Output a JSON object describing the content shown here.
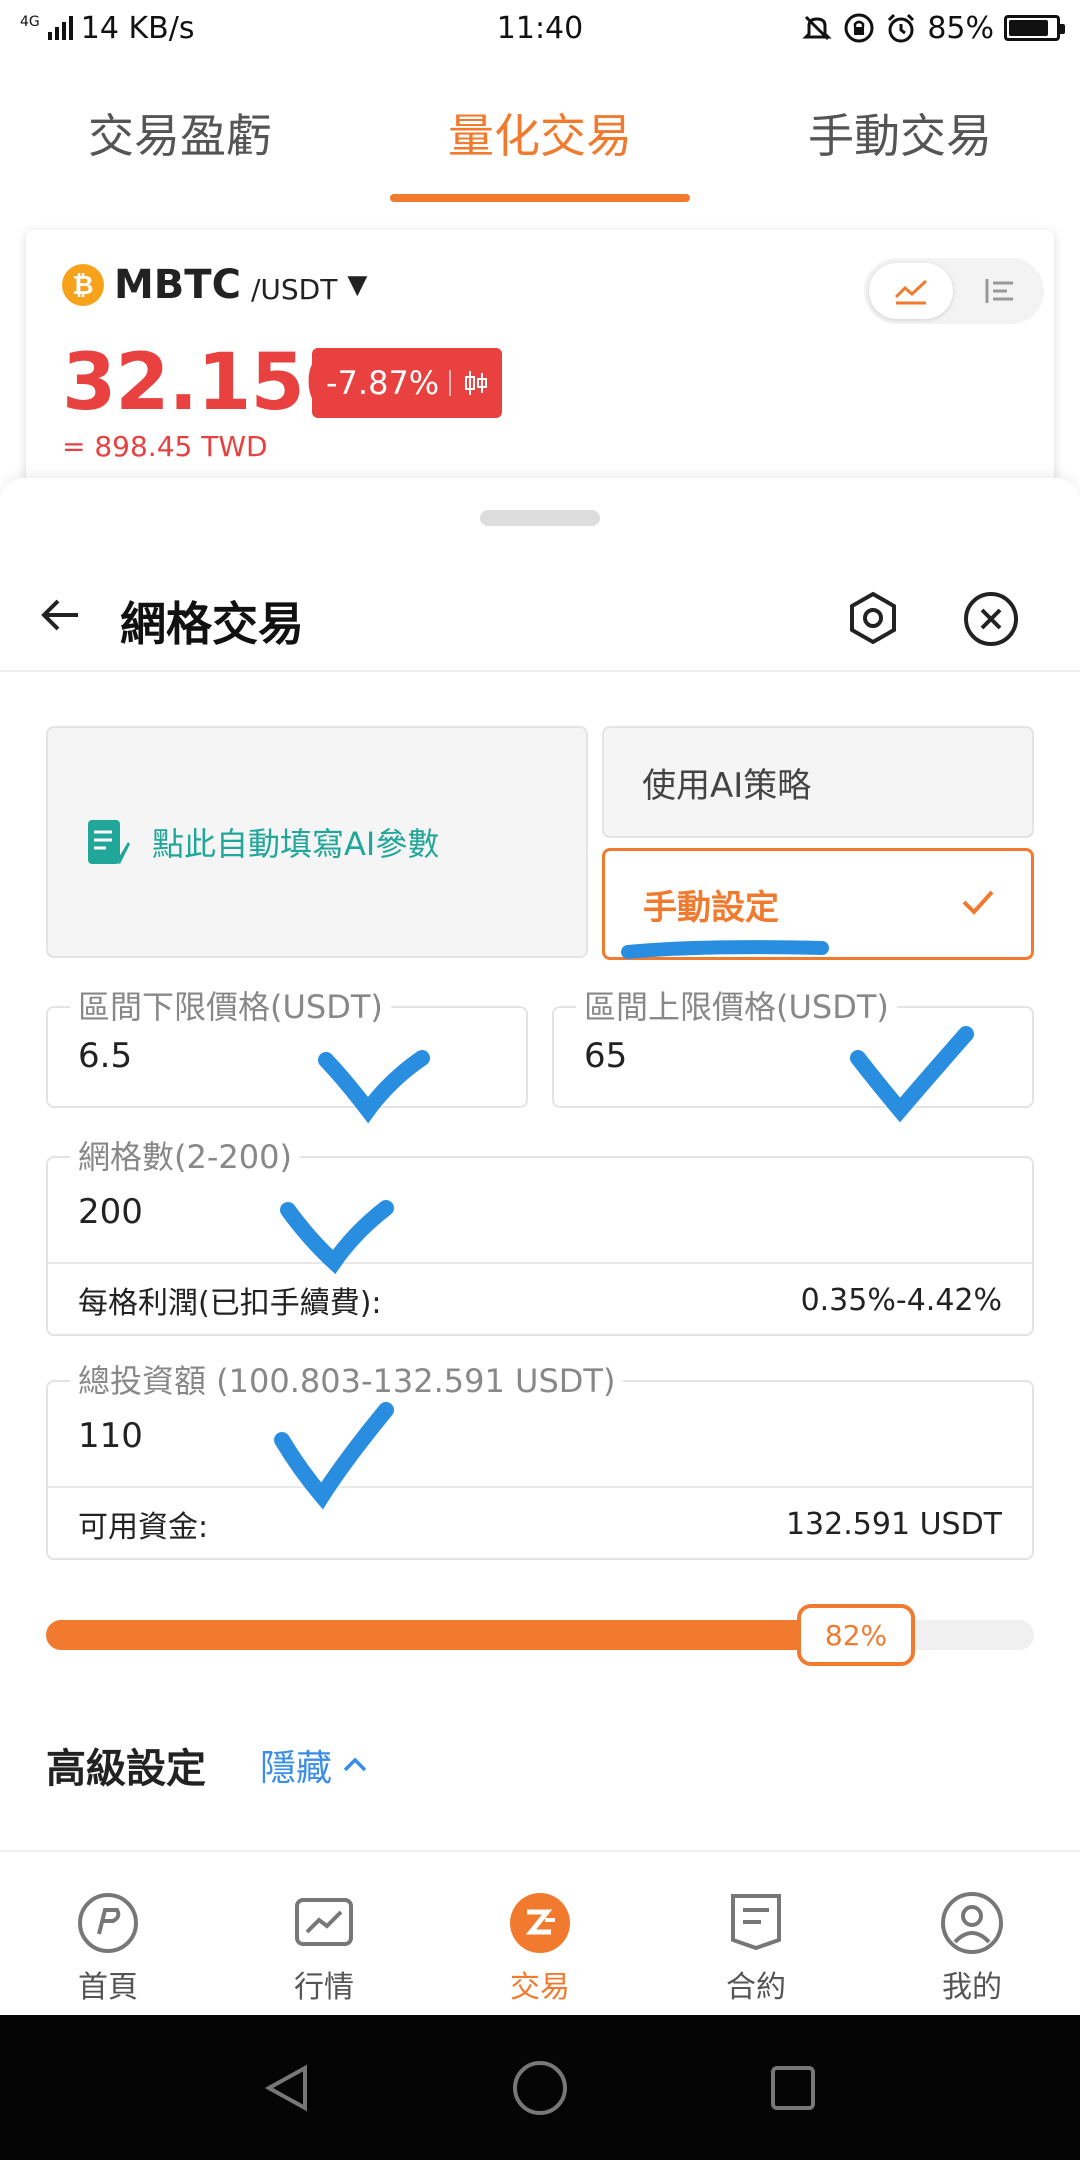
{
  "status_bar": {
    "network": "4G",
    "speed": "14 KB/s",
    "time": "11:40",
    "battery": "85%",
    "battery_level": 0.85,
    "icons": [
      "mute-icon",
      "lock-rotation-icon",
      "alarm-icon",
      "battery-icon"
    ]
  },
  "top_tabs": [
    {
      "label": "交易盈虧",
      "active": false
    },
    {
      "label": "量化交易",
      "active": true
    },
    {
      "label": "手動交易",
      "active": false
    }
  ],
  "market": {
    "coin_symbol": "₿",
    "base": "MBTC",
    "quote": "/USDT",
    "caret": "▼",
    "price": "32.156",
    "change": "-7.87%",
    "fiat_value": "= 898.45 TWD",
    "view_modes": [
      "line-chart-icon",
      "list-icon"
    ]
  },
  "sheet": {
    "title": "網格交易",
    "ai_fill_label": "點此自動填寫AI參數",
    "mode_ai": "使用AI策略",
    "mode_manual": "手動設定",
    "lower_price": {
      "label": "區間下限價格(USDT)",
      "value": "6.5"
    },
    "upper_price": {
      "label": "區間上限價格(USDT)",
      "value": "65"
    },
    "grid_count": {
      "label": "網格數(2-200)",
      "value": "200"
    },
    "profit_per_grid": {
      "label": "每格利潤(已扣手續費):",
      "value": "0.35%-4.42%"
    },
    "total_investment": {
      "label": "總投資額 (100.803-132.591 USDT)",
      "value": "110"
    },
    "available_funds": {
      "label": "可用資金:",
      "value": "132.591 USDT"
    },
    "slider": {
      "percent_label": "82%",
      "percent": 82
    },
    "advanced_title": "高級設定",
    "advanced_toggle": "隱藏"
  },
  "bottom_nav": [
    {
      "label": "首頁",
      "icon": "home-icon",
      "active": false
    },
    {
      "label": "行情",
      "icon": "market-chart-icon",
      "active": false
    },
    {
      "label": "交易",
      "icon": "trade-icon",
      "active": true
    },
    {
      "label": "合約",
      "icon": "contract-icon",
      "active": false
    },
    {
      "label": "我的",
      "icon": "profile-icon",
      "active": false
    }
  ],
  "colors": {
    "accent": "#f27a2e",
    "down_red": "#e8413f",
    "teal": "#21a79a",
    "link_blue": "#3a8ee6",
    "annotation_blue": "#2a8ee0"
  }
}
